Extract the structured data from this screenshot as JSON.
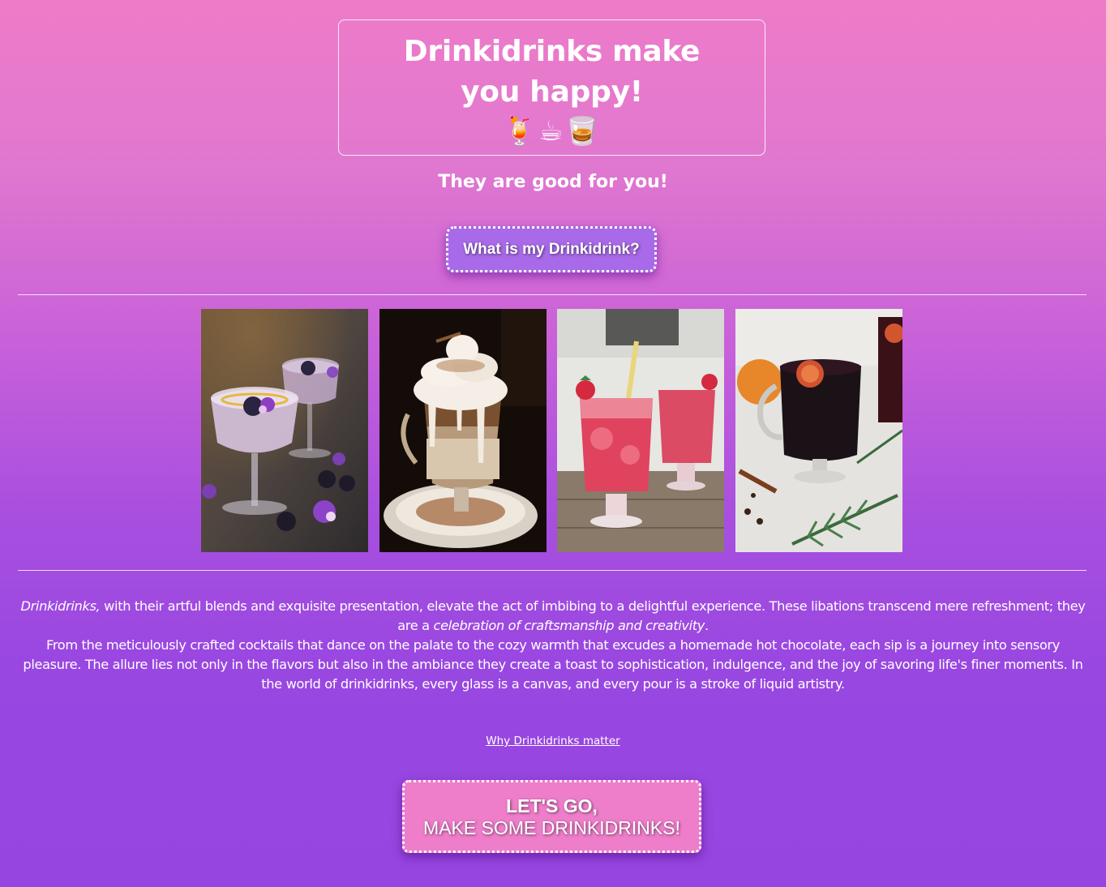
{
  "header": {
    "title": "Drinkidrinks make you happy!",
    "emojis": "🍹☕🥃",
    "subtitle": "They are good for you!"
  },
  "quiz_button": {
    "label": "What is my Drinkidrink?"
  },
  "gallery": {
    "photos": [
      {
        "name": "photo-lavender-cocktail",
        "icon": "lavender-cocktail-photo"
      },
      {
        "name": "photo-hot-chocolate",
        "icon": "whipped-cream-hot-chocolate-photo"
      },
      {
        "name": "photo-strawberry-drink",
        "icon": "strawberry-lemonade-photo"
      },
      {
        "name": "photo-mulled-wine",
        "icon": "mulled-wine-photo"
      }
    ]
  },
  "description": {
    "p1_em": "Drinkidrinks,",
    "p1_text": " with their artful blends and exquisite presentation, elevate the act of imbibing to a delightful experience. These libations transcend mere refreshment; they are a ",
    "p1_em2": "celebration of craftsmanship and creativity",
    "p1_end": ".",
    "p2": "From the meticulously crafted cocktails that dance on the palate to the cozy warmth that excudes a homemade hot chocolate, each sip is a journey into sensory pleasure. The allure lies not only in the flavors but also in the ambiance they create a toast to sophistication, indulgence, and the joy of savoring life's finer moments. In the world of drinkidrinks, every glass is a canvas, and every pour is a stroke of liquid artistry."
  },
  "link": {
    "label": "Why Drinkidrinks matter"
  },
  "cta": {
    "line1": "LET'S GO,",
    "line2": "MAKE SOME DRINKIDRINKS!"
  },
  "colors": {
    "gradient_top": "#ee7bc8",
    "gradient_bottom": "#9645e1",
    "quiz_button": "#a86ae8",
    "cta_button": "#ee7dca"
  }
}
